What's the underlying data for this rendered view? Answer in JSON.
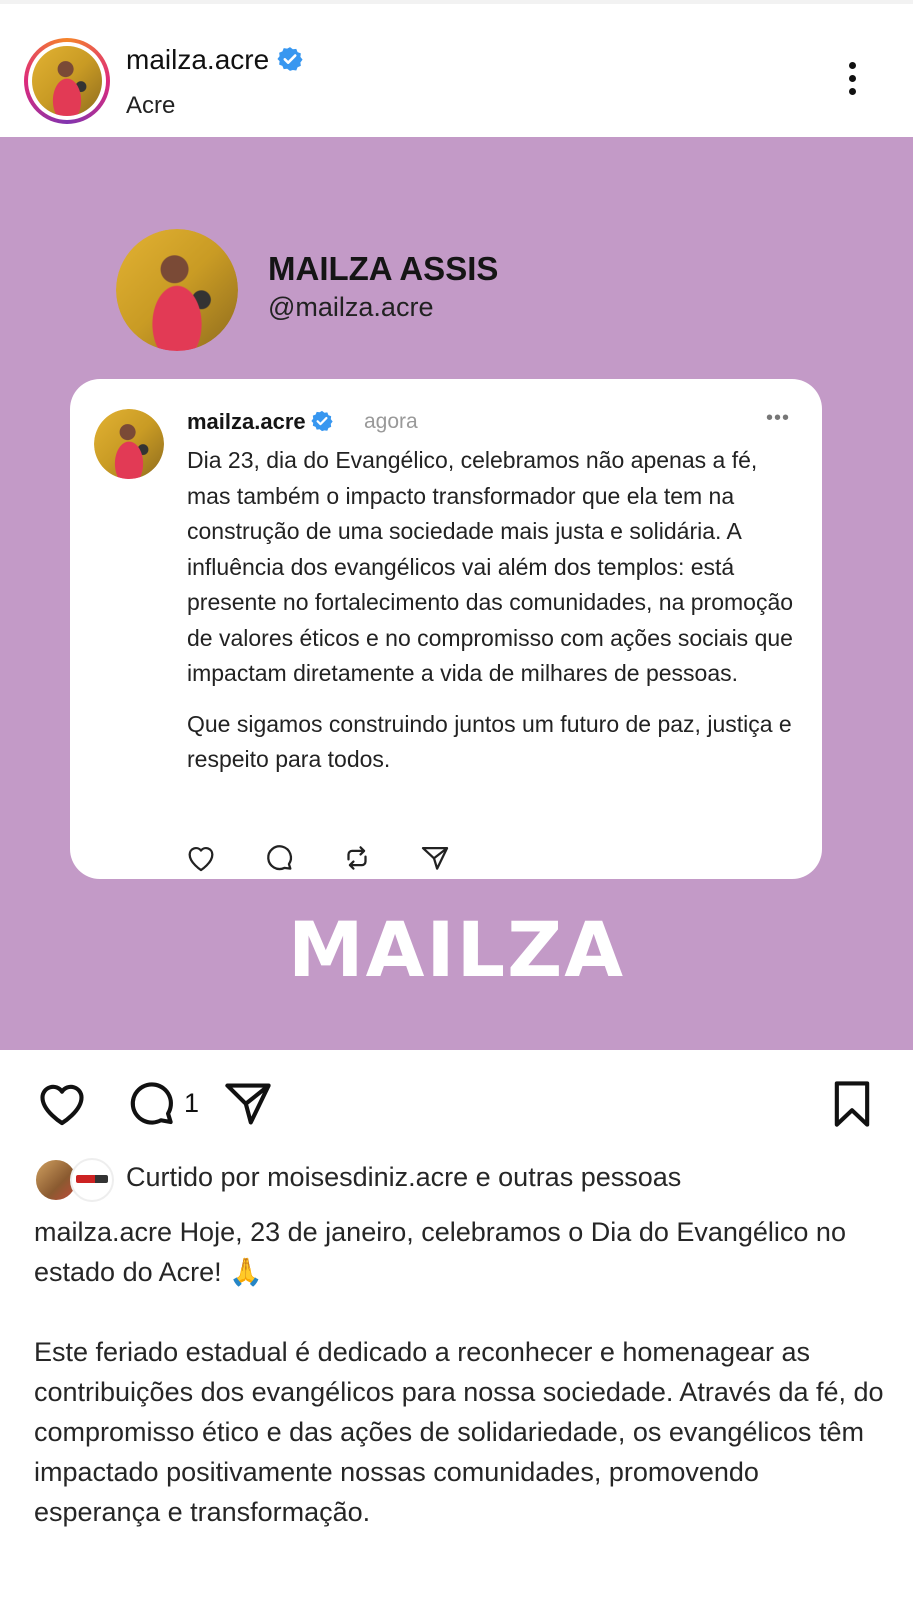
{
  "header": {
    "username": "mailza.acre",
    "location": "Acre"
  },
  "media": {
    "profile_name": "MAILZA ASSIS",
    "profile_handle": "@mailza.acre",
    "card": {
      "username": "mailza.acre",
      "time": "agora",
      "more": "•••",
      "paragraphs": [
        "Dia 23, dia do Evangélico, celebramos não apenas a fé, mas também o impacto transformador que ela tem na construção de uma sociedade mais justa e solidária. A influência dos evangélicos vai além dos templos: está presente no fortalecimento das comunidades, na promoção de valores éticos e no compromisso com ações sociais que impactam diretamente a vida de milhares de pessoas.",
        "Que sigamos construindo juntos um futuro de paz, justiça e respeito para todos."
      ]
    },
    "brand": "MAILZA"
  },
  "actions": {
    "comment_count": "1"
  },
  "likes": {
    "text": "Curtido por moisesdiniz.acre e outras pessoas"
  },
  "caption": {
    "username": "mailza.acre",
    "first": "Hoje, 23 de janeiro, celebramos o Dia do Evangélico no estado do Acre! 🙏",
    "second": "Este feriado estadual é dedicado a reconhecer e homenagear as contribuições dos evangélicos para nossa sociedade. Através da fé, do compromisso ético e das ações de solidariedade, os evangélicos têm impactado positivamente nossas comunidades, promovendo esperança e transformação."
  },
  "colors": {
    "media_background": "#c39ac7",
    "verified": "#3897f0"
  },
  "icons": [
    "verified-icon",
    "more-icon",
    "heart-icon",
    "comment-icon",
    "repost-icon",
    "share-icon",
    "bookmark-icon"
  ]
}
